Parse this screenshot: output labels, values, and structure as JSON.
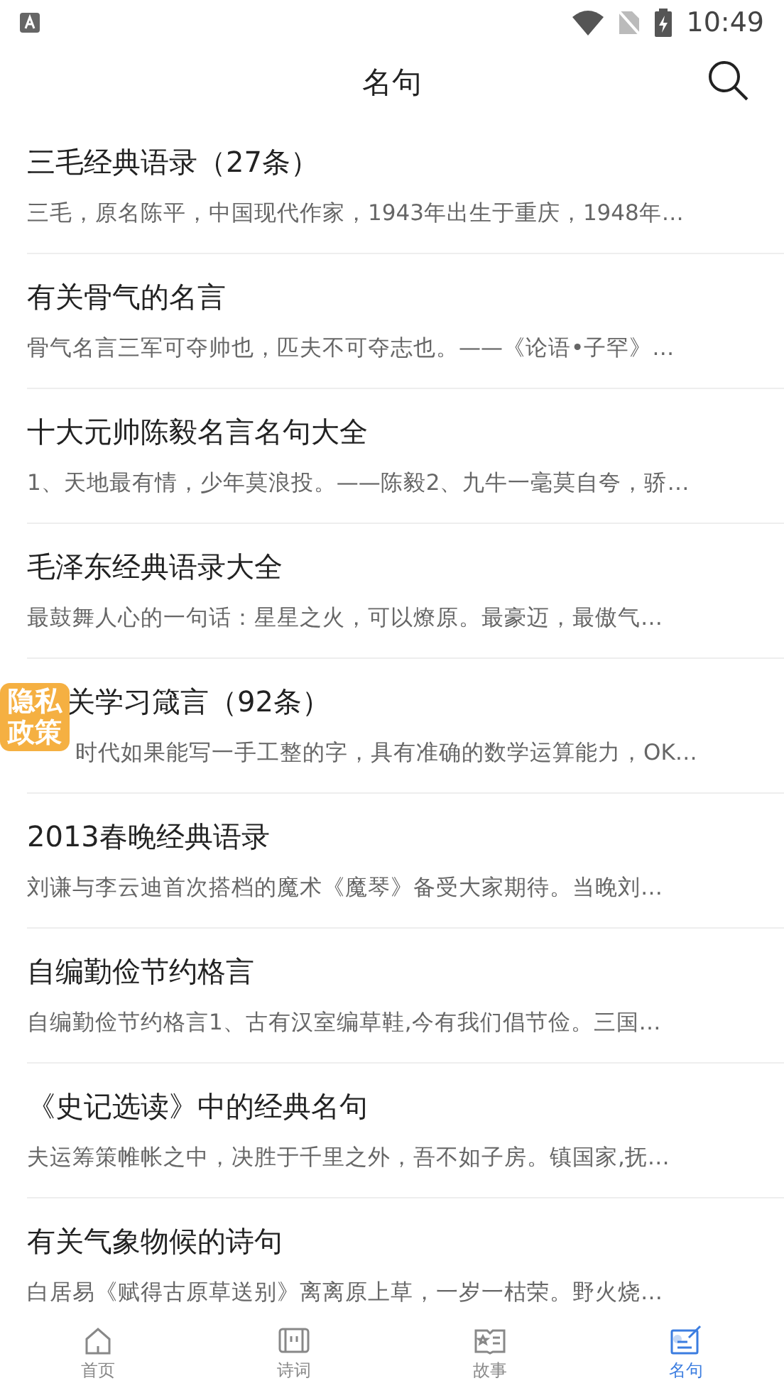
{
  "status_bar": {
    "time": "10:49"
  },
  "header": {
    "title": "名句"
  },
  "items": [
    {
      "kind": "plain",
      "title": "三毛经典语录（27条）",
      "summary": "三毛，原名陈平，中国现代作家，1943年出生于重庆，1948年…"
    },
    {
      "kind": "plain",
      "title": "有关骨气的名言",
      "summary": "骨气名言三军可夺帅也，匹夫不可夺志也。——《论语•子罕》…"
    },
    {
      "kind": "plain",
      "title": "十大元帅陈毅名言名句大全",
      "summary": "1、天地最有情，少年莫浪投。——陈毅2、九牛一毫莫自夸，骄…"
    },
    {
      "kind": "plain",
      "title": "毛泽东经典语录大全",
      "summary": "最鼓舞人心的一句话：星星之火，可以燎原。最豪迈，最傲气…"
    },
    {
      "kind": "covered",
      "title": "关学习箴言（92条）",
      "summary": "时代如果能写一手工整的字，具有准确的数学运算能力，OK…"
    },
    {
      "kind": "plain",
      "title": "2013春晚经典语录",
      "summary": "刘谦与李云迪首次搭档的魔术《魔琴》备受大家期待。当晚刘…"
    },
    {
      "kind": "plain",
      "title": "自编勤俭节约格言",
      "summary": "自编勤俭节约格言1、古有汉室编草鞋,今有我们倡节俭。三国…"
    },
    {
      "kind": "plain",
      "title": "《史记选读》中的经典名句",
      "summary": "夫运筹策帷帐之中，决胜于千里之外，吾不如子房。镇国家,抚…"
    },
    {
      "kind": "plain",
      "title": "有关气象物候的诗句",
      "summary": "白居易《赋得古原草送别》离离原上草，一岁一枯荣。野火烧…"
    }
  ],
  "floating_badge": {
    "lines": [
      "隐私",
      "政策"
    ]
  },
  "tabs": [
    {
      "kind": "home",
      "label": "首页",
      "selected": false
    },
    {
      "kind": "scroll",
      "label": "诗词",
      "selected": false
    },
    {
      "kind": "book",
      "label": "故事",
      "selected": false
    },
    {
      "kind": "note",
      "label": "名句",
      "selected": true
    }
  ]
}
